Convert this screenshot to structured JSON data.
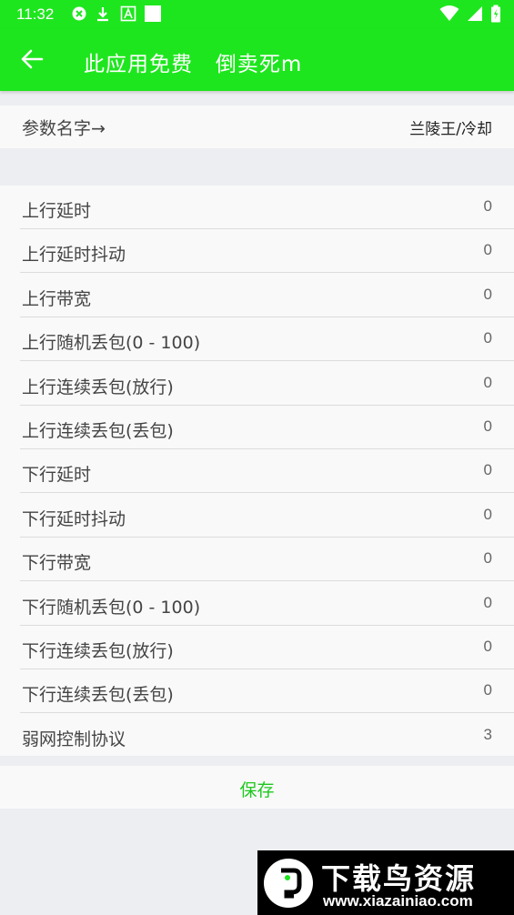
{
  "status_bar": {
    "time": "11:32",
    "icons": [
      "notification-x-icon",
      "download-icon",
      "font-a-icon",
      "square-icon"
    ],
    "right_icons": [
      "wifi-icon",
      "signal-icon",
      "battery-icon"
    ]
  },
  "app_bar": {
    "title": "此应用免费   倒卖死m",
    "back_icon": "arrow-left-icon"
  },
  "name_row": {
    "label": "参数名字→",
    "value": "兰陵王/冷却"
  },
  "params": [
    {
      "label": "上行延时",
      "value": "0"
    },
    {
      "label": "上行延时抖动",
      "value": "0"
    },
    {
      "label": "上行带宽",
      "value": "0"
    },
    {
      "label": "上行随机丢包(0 - 100)",
      "value": "0"
    },
    {
      "label": "上行连续丢包(放行)",
      "value": "0"
    },
    {
      "label": "上行连续丢包(丢包)",
      "value": "0"
    },
    {
      "label": "下行延时",
      "value": "0"
    },
    {
      "label": "下行延时抖动",
      "value": "0"
    },
    {
      "label": "下行带宽",
      "value": "0"
    },
    {
      "label": "下行随机丢包(0 - 100)",
      "value": "0"
    },
    {
      "label": "下行连续丢包(放行)",
      "value": "0"
    },
    {
      "label": "下行连续丢包(丢包)",
      "value": "0"
    },
    {
      "label": "弱网控制协议",
      "value": "3"
    }
  ],
  "save_label": "保存",
  "watermark": {
    "brand": "下载鸟资源",
    "url": "www.xiazainiao.com"
  },
  "colors": {
    "accent": "#1ee61e",
    "save_text": "#1ec81e",
    "background": "#eceef1",
    "row": "#f9f9f9"
  }
}
